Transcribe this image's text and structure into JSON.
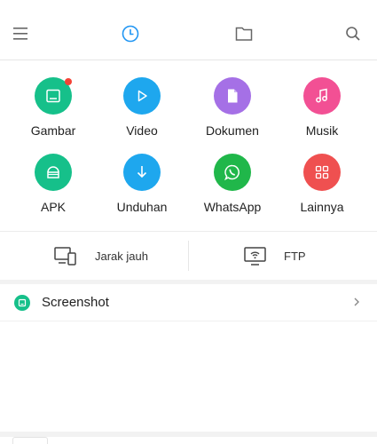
{
  "topbar": {
    "icons": [
      "menu-icon",
      "clock-icon",
      "folder-icon",
      "search-icon"
    ],
    "active_color": "#2196f3"
  },
  "categories": [
    {
      "label": "Gambar",
      "icon": "image-icon",
      "color": "#16c08a",
      "badge": true
    },
    {
      "label": "Video",
      "icon": "play-icon",
      "color": "#1ea7ee",
      "badge": false
    },
    {
      "label": "Dokumen",
      "icon": "document-icon",
      "color": "#a570e6",
      "badge": false
    },
    {
      "label": "Musik",
      "icon": "music-icon",
      "color": "#f25094",
      "badge": false
    },
    {
      "label": "APK",
      "icon": "android-icon",
      "color": "#16c08a",
      "badge": false
    },
    {
      "label": "Unduhan",
      "icon": "download-icon",
      "color": "#1ea7ee",
      "badge": false
    },
    {
      "label": "WhatsApp",
      "icon": "whatsapp-icon",
      "color": "#20b74a",
      "badge": false
    },
    {
      "label": "Lainnya",
      "icon": "grid-icon",
      "color": "#ef5050",
      "badge": false
    }
  ],
  "remote": {
    "remote_label": "Jarak jauh",
    "ftp_label": "FTP"
  },
  "recent": {
    "section_label": "Screenshot",
    "icon": "screenshot-icon",
    "color": "#16c08a"
  }
}
